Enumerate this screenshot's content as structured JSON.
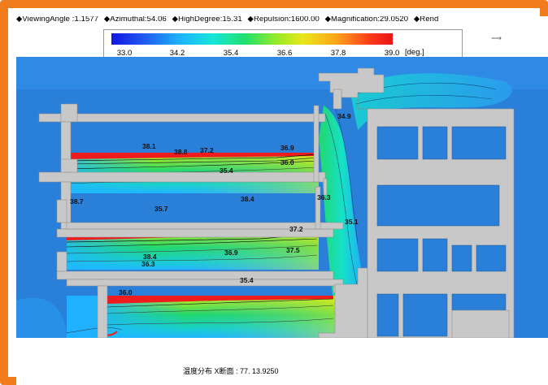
{
  "header": {
    "items": [
      "◆ViewingAngle :1.1577",
      "◆Azimuthal:54.06",
      "◆HighDegree:15.31",
      "◆Repulsion:1600.00",
      "◆Magnification:29.0520",
      "◆Rend"
    ]
  },
  "colorbar": {
    "ticks": [
      "33.0",
      "34.2",
      "35.4",
      "36.6",
      "37.8",
      "39.0"
    ],
    "unit": "[deg.]"
  },
  "contour_labels": [
    {
      "text": "34.9"
    },
    {
      "text": "38.1"
    },
    {
      "text": "38.8"
    },
    {
      "text": "37.2"
    },
    {
      "text": "36.9"
    },
    {
      "text": "35.4"
    },
    {
      "text": "36.0"
    },
    {
      "text": "38.7"
    },
    {
      "text": "38.4"
    },
    {
      "text": "35.7"
    },
    {
      "text": "36.3"
    },
    {
      "text": "35.1"
    },
    {
      "text": "37.2"
    },
    {
      "text": "38.4"
    },
    {
      "text": "36.3"
    },
    {
      "text": "36.9"
    },
    {
      "text": "37.5"
    },
    {
      "text": "35.4"
    },
    {
      "text": "36.0"
    }
  ],
  "footer": {
    "caption": "温度分布 X断面 : 77. 13.9250"
  },
  "colors": {
    "frame": "#f07c1c",
    "field_base": "#2a7fd8",
    "building": "#c8c8c8",
    "hot": "#ee1c1c"
  }
}
